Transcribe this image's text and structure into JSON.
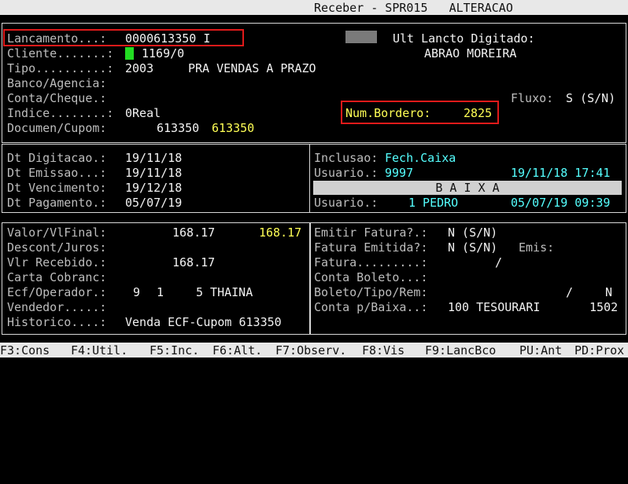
{
  "window": {
    "title": "Receber - SPR015   ALTERACAO"
  },
  "top": {
    "lancamento_label": "Lancamento...:",
    "lancamento_value": "0000613350 I",
    "ult_lancto_label": "Ult Lancto Digitado:",
    "ult_lancto_name": "ABRAO MOREIRA",
    "cliente_label": "Cliente.......:",
    "cliente_value": "1169/0",
    "tipo_label": "Tipo..........:",
    "tipo_code": "2003",
    "tipo_desc": "PRA VENDAS A PRAZO",
    "banco_label": "Banco/Agencia:",
    "conta_label": "Conta/Cheque.:",
    "fluxo_label": "Fluxo:",
    "fluxo_value": "S (S/N)",
    "indice_label": "Indice........:",
    "indice_value": "0Real",
    "bordero_label": "Num.Bordero:",
    "bordero_value": "2825",
    "documen_label": "Documen/Cupom:",
    "documen_value": "613350",
    "documen_value2": "613350"
  },
  "dates": {
    "digitacao_label": "Dt Digitacao.:",
    "digitacao_value": "19/11/18",
    "emissao_label": "Dt Emissao...:",
    "emissao_value": "19/11/18",
    "vencimento_label": "Dt Vencimento:",
    "vencimento_value": "19/12/18",
    "pagamento_label": "Dt Pagamento.:",
    "pagamento_value": "05/07/19"
  },
  "audit": {
    "inclusao_label": "Inclusao:",
    "inclusao_value": "Fech.Caixa",
    "usuario1_label": "Usuario.:",
    "usuario1_value": "9997",
    "usuario1_datetime": "19/11/18 17:41",
    "baixa_label": "B A I X A",
    "usuario2_label": "Usuario.:",
    "usuario2_value": "1 PEDRO",
    "usuario2_datetime": "05/07/19 09:39"
  },
  "values": {
    "valor_label": "Valor/VlFinal:",
    "valor_value": "168.17",
    "valor_final": "168.17",
    "descont_label": "Descont/Juros:",
    "recebido_label": "Vlr Recebido.:",
    "recebido_value": "168.17",
    "carta_label": "Carta Cobranc:",
    "ecf_label": "Ecf/Operador.:",
    "ecf_a": "9",
    "ecf_b": "1",
    "ecf_c": "5 THAINA",
    "vendedor_label": "Vendedor.....:",
    "historico_label": "Historico....:",
    "historico_value": "Venda ECF-Cupom 613350"
  },
  "billing": {
    "emitir_label": "Emitir Fatura?.:",
    "emitir_value": "N (S/N)",
    "emitida_label": "Fatura Emitida?:",
    "emitida_value": "N (S/N)",
    "emis_label": "Emis:",
    "fatura_label": "Fatura.........:",
    "fatura_value": "/",
    "boleto_label": "Conta Boleto...:",
    "boleto_tipo_label": "Boleto/Tipo/Rem:",
    "boleto_tipo_value": "/",
    "boleto_tipo_n": "N",
    "conta_baixa_label": "Conta p/Baixa..:",
    "conta_baixa_value": "100 TESOURARI",
    "conta_baixa_num": "1502"
  },
  "footer": {
    "f3": "F3:Cons",
    "f4": "F4:Util.",
    "f5": "F5:Inc.",
    "f6": "F6:Alt.",
    "f7": "F7:Observ.",
    "f8": "F8:Vis",
    "f9": "F9:LancBco",
    "pu": "PU:Ant",
    "pd": "PD:Prox"
  }
}
